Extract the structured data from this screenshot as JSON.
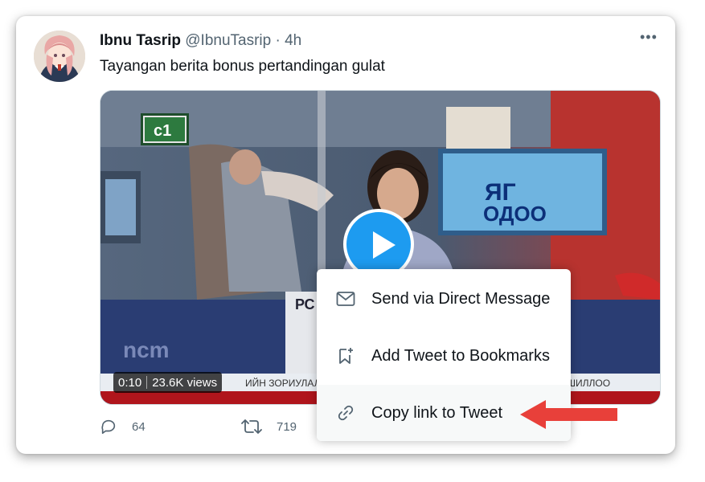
{
  "tweet": {
    "author_name": "Ibnu Tasrip",
    "handle": "@IbnuTasrip",
    "time": "· 4h",
    "more": "•••",
    "text": "Tayangan berita bonus pertandingan gulat"
  },
  "media": {
    "duration": "0:10",
    "views": "23.6K views",
    "channel_logo": "c1",
    "screen_text_line1": "ЯГ",
    "screen_text_line2": "ОДОО",
    "desk_text": "РС",
    "watermark": "ncm",
    "ticker_left": "ИЙН ЗОРИУЛАЛТА",
    "ticker_right": "ШИЛЛОО"
  },
  "actions": {
    "replies": "64",
    "retweets": "719"
  },
  "share_menu": {
    "items": [
      {
        "label": "Send via Direct Message",
        "icon": "envelope-icon"
      },
      {
        "label": "Add Tweet to Bookmarks",
        "icon": "bookmark-add-icon"
      },
      {
        "label": "Copy link to Tweet",
        "icon": "link-icon"
      }
    ]
  },
  "colors": {
    "accent": "#1d9bf0",
    "annotation_arrow": "#e8403a",
    "text_primary": "#0f1419",
    "text_secondary": "#536471"
  }
}
